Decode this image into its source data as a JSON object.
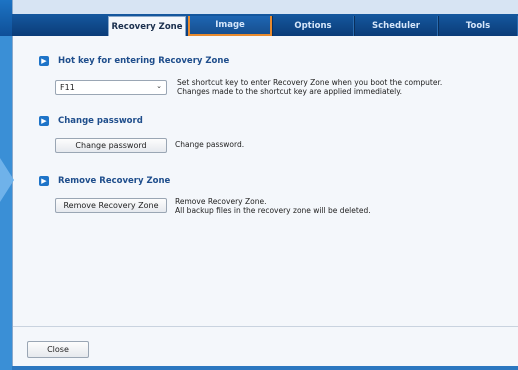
{
  "tabs": [
    {
      "label": "Recovery Zone"
    },
    {
      "label": "Image"
    },
    {
      "label": "Options"
    },
    {
      "label": "Scheduler"
    },
    {
      "label": "Tools"
    }
  ],
  "hotkey": {
    "title": "Hot key for entering Recovery Zone",
    "selected": "F11",
    "desc1": "Set shortcut key to enter Recovery Zone when you boot the computer.",
    "desc2": "Changes made to the shortcut key are applied immediately."
  },
  "password": {
    "title": "Change password",
    "button": "Change password",
    "desc": "Change password."
  },
  "remove": {
    "title": "Remove Recovery Zone",
    "button": "Remove Recovery Zone",
    "desc1": "Remove Recovery Zone.",
    "desc2": "All backup files in the recovery zone will be deleted."
  },
  "footer": {
    "close": "Close"
  },
  "colors": {
    "accent": "#1e74c8",
    "hover_outline": "#e88a2e",
    "title_text": "#1f4e8c"
  }
}
